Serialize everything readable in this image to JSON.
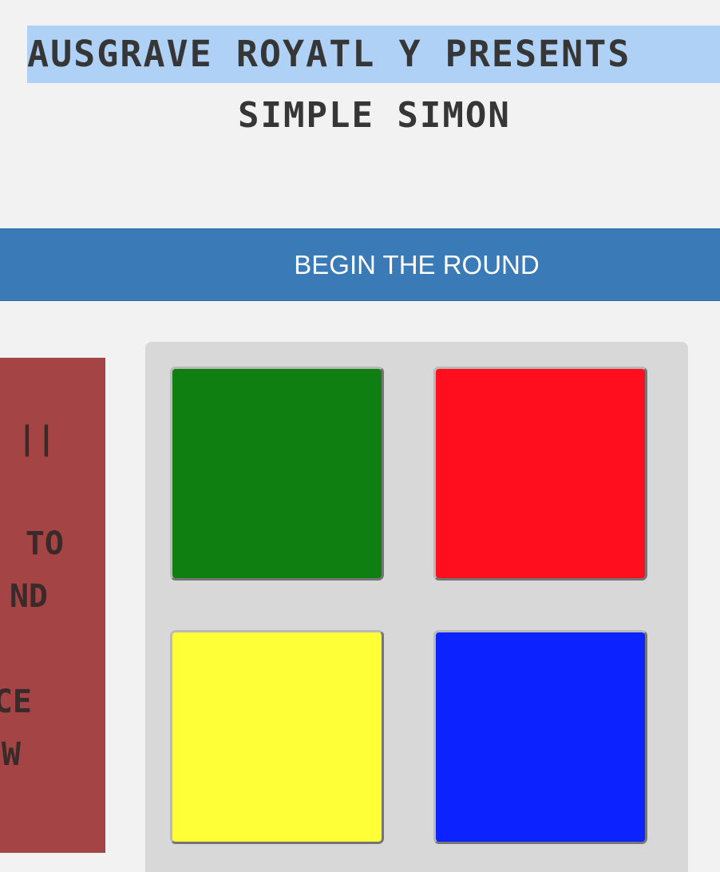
{
  "header": {
    "title_line_1": "AUSGRAVE ROYATL Y PRESENTS",
    "title_line_2": "SIMPLE SIMON"
  },
  "controls": {
    "begin_label": "BEGIN THE ROUND"
  },
  "side_panel": {
    "lines": [
      "S ||",
      "TO",
      "ND",
      "CE",
      "W"
    ]
  },
  "board": {
    "pads": [
      {
        "name": "green",
        "color": "#0f7f12"
      },
      {
        "name": "red",
        "color": "#ff0f1e"
      },
      {
        "name": "yellow",
        "color": "#ffff38"
      },
      {
        "name": "blue",
        "color": "#0c22ff"
      }
    ]
  }
}
